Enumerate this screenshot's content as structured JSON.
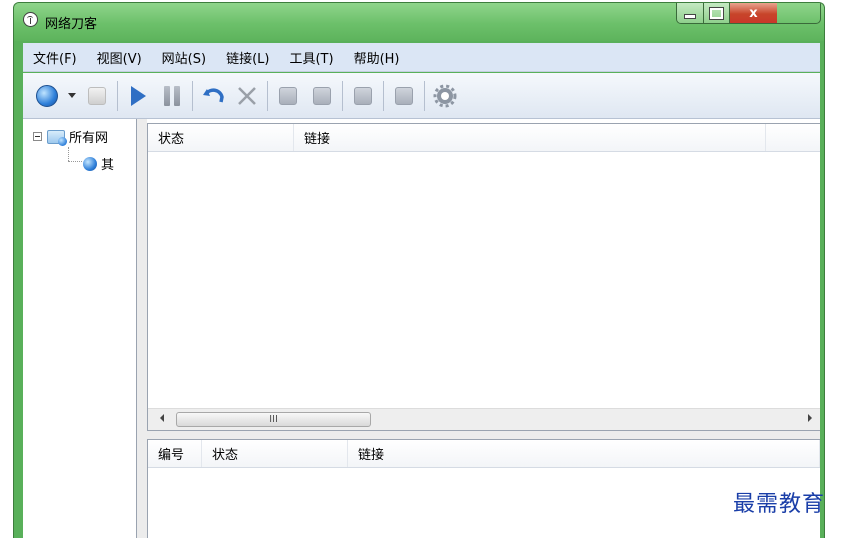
{
  "window": {
    "title": "网络刀客",
    "controls": {
      "close_glyph": "x"
    }
  },
  "menu": {
    "items": [
      "文件(F)",
      "视图(V)",
      "网站(S)",
      "链接(L)",
      "工具(T)",
      "帮助(H)"
    ]
  },
  "toolbar": {
    "buttons": [
      "globe-icon",
      "dropdown-arrow-icon",
      "page-icon",
      "play-icon",
      "pause-icon",
      "undo-icon",
      "delete-icon",
      "download-icon",
      "refresh-icon",
      "stop-icon",
      "remove-icon",
      "settings-icon"
    ]
  },
  "tree": {
    "root_label": "所有网",
    "child_label": "其"
  },
  "links_list": {
    "columns": [
      "状态",
      "链接"
    ],
    "scroll_grip": "III"
  },
  "detail_list": {
    "columns": [
      "编号",
      "状态",
      "链接"
    ]
  },
  "watermark": "最需教育",
  "colors": {
    "titlebar": "#6cc06a",
    "menubar": "#dbe6f5",
    "accent_blue": "#2f6fc4"
  }
}
